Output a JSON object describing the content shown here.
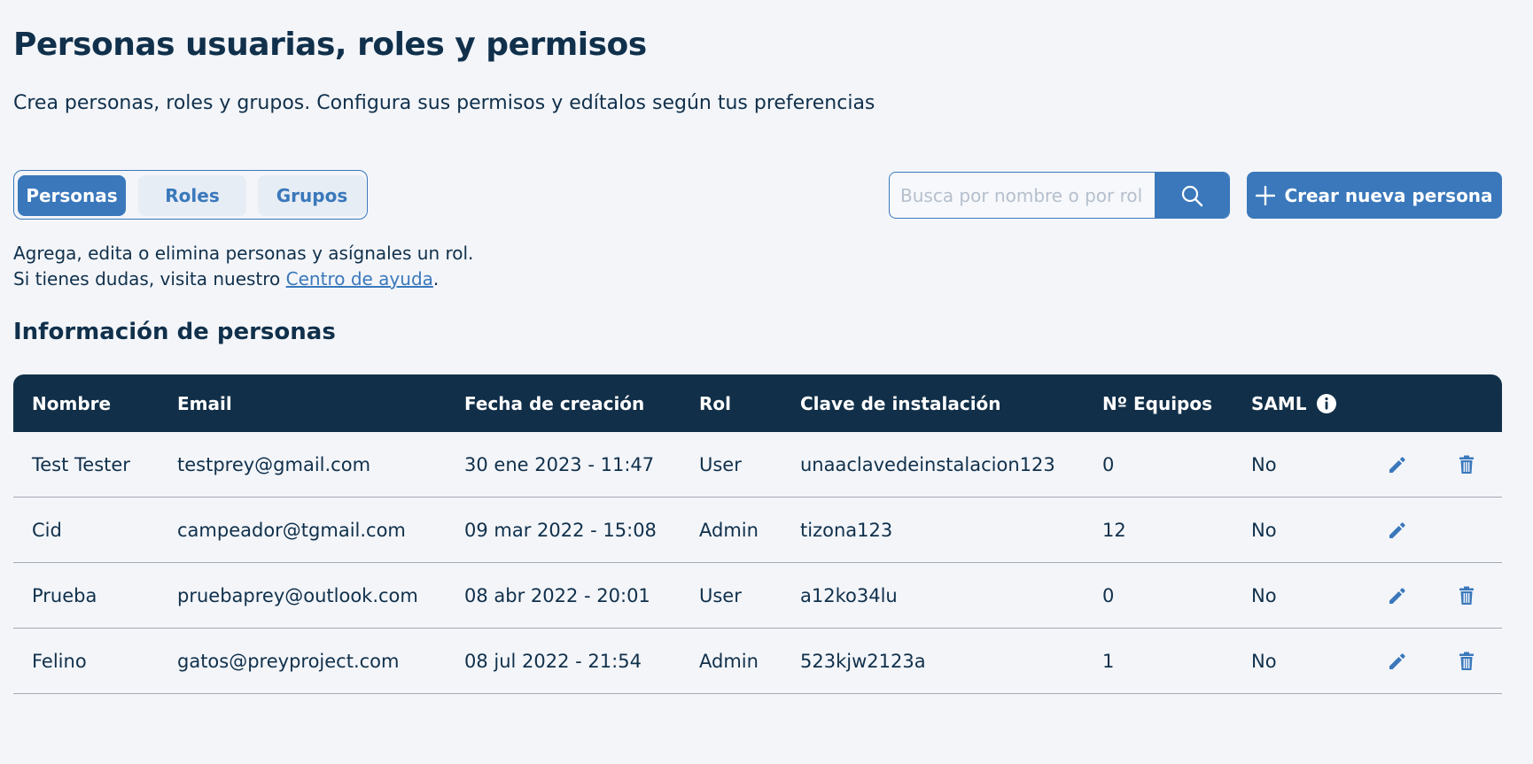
{
  "header": {
    "title": "Personas usuarias, roles y permisos",
    "subtitle": "Crea personas, roles y grupos. Configura sus permisos y edítalos según tus preferencias"
  },
  "tabs": [
    {
      "label": "Personas",
      "active": true
    },
    {
      "label": "Roles",
      "active": false
    },
    {
      "label": "Grupos",
      "active": false
    }
  ],
  "search": {
    "placeholder": "Busca por nombre o por rol",
    "value": "",
    "icon": "search-icon"
  },
  "create_button": {
    "icon": "plus-icon",
    "label": "Crear nueva persona"
  },
  "description": {
    "line1": "Agrega, edita o elimina personas y asígnales un rol.",
    "line2_prefix": "Si tienes dudas, visita nuestro ",
    "link": "Centro de ayuda",
    "line2_suffix": "."
  },
  "section_title": "Información de personas",
  "table": {
    "columns": {
      "name": "Nombre",
      "email": "Email",
      "date": "Fecha de creación",
      "role": "Rol",
      "key": "Clave de instalación",
      "count": "Nº Equipos",
      "saml": "SAML"
    },
    "rows": [
      {
        "name": "Test Tester",
        "email": "testprey@gmail.com",
        "date": "30 ene 2023 - 11:47",
        "role": "User",
        "key": "unaaclavedeinstalacion123",
        "count": "0",
        "saml": "No",
        "deletable": true
      },
      {
        "name": "Cid",
        "email": "campeador@tgmail.com",
        "date": "09 mar 2022 - 15:08",
        "role": "Admin",
        "key": "tizona123",
        "count": "12",
        "saml": "No",
        "deletable": false
      },
      {
        "name": "Prueba",
        "email": "pruebaprey@outlook.com",
        "date": "08 abr 2022 - 20:01",
        "role": "User",
        "key": "a12ko34lu",
        "count": "0",
        "saml": "No",
        "deletable": true
      },
      {
        "name": "Felino",
        "email": "gatos@preyproject.com",
        "date": "08 jul 2022 - 21:54",
        "role": "Admin",
        "key": "523kjw2123a",
        "count": "1",
        "saml": "No",
        "deletable": true
      }
    ]
  },
  "colors": {
    "primary": "#3a78bb",
    "header_bg": "#112f48",
    "text": "#10304b",
    "background": "#f3f5f9"
  }
}
